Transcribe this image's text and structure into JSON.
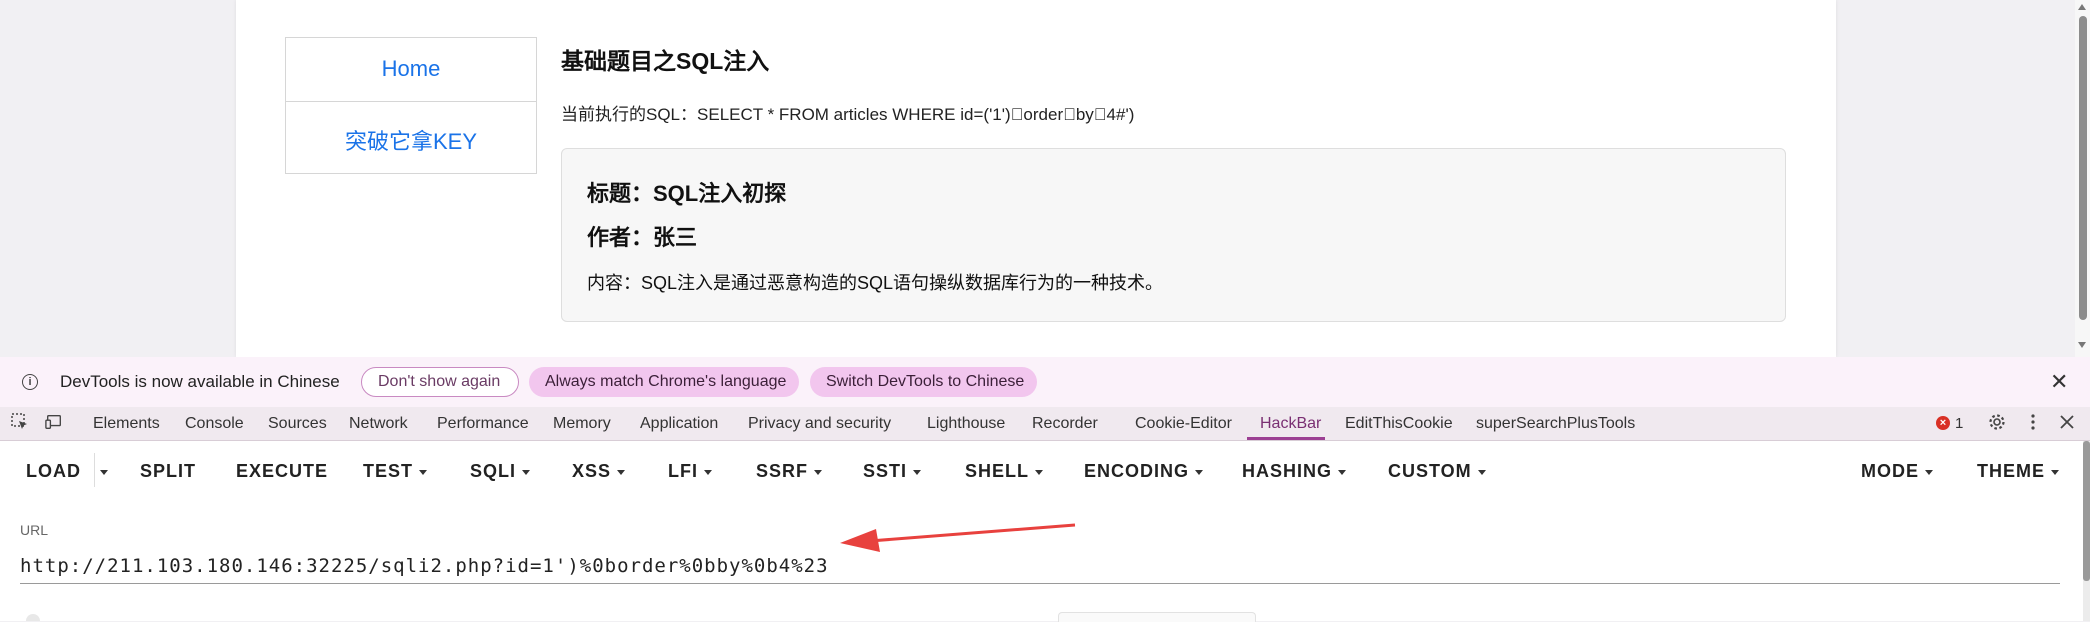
{
  "page": {
    "nav": [
      {
        "label": "Home"
      },
      {
        "label": "突破它拿KEY"
      }
    ],
    "heading": "基础题目之SQL注入",
    "sql_line": "当前执行的SQL：SELECT * FROM articles WHERE id=('1')\u0000order\u0000by\u00004#')",
    "card": {
      "title": "标题：SQL注入初探",
      "author": "作者：张三",
      "content": "内容：SQL注入是通过恶意构造的SQL语句操纵数据库行为的一种技术。"
    }
  },
  "infobar": {
    "message": "DevTools is now available in Chinese",
    "dont_show": "Don't show again",
    "match_lang": "Always match Chrome's language",
    "switch_lang": "Switch DevTools to Chinese"
  },
  "tabs": [
    "Elements",
    "Console",
    "Sources",
    "Network",
    "Performance",
    "Memory",
    "Application",
    "Privacy and security",
    "Lighthouse",
    "Recorder",
    "Cookie-Editor",
    "HackBar",
    "EditThisCookie",
    "superSearchPlusTools"
  ],
  "active_tab": "HackBar",
  "error_count": "1",
  "hackbar": {
    "buttons": [
      "LOAD",
      "SPLIT",
      "EXECUTE",
      "TEST",
      "SQLI",
      "XSS",
      "LFI",
      "SSRF",
      "SSTI",
      "SHELL",
      "ENCODING",
      "HASHING",
      "CUSTOM",
      "MODE",
      "THEME"
    ],
    "url_label": "URL",
    "url_value": "http://211.103.180.146:32225/sqli2.php?id=1')%0border%0bby%0b4%23"
  },
  "colors": {
    "accent": "#9c3f93",
    "link": "#1a73e8",
    "arrow": "#e8413e"
  }
}
